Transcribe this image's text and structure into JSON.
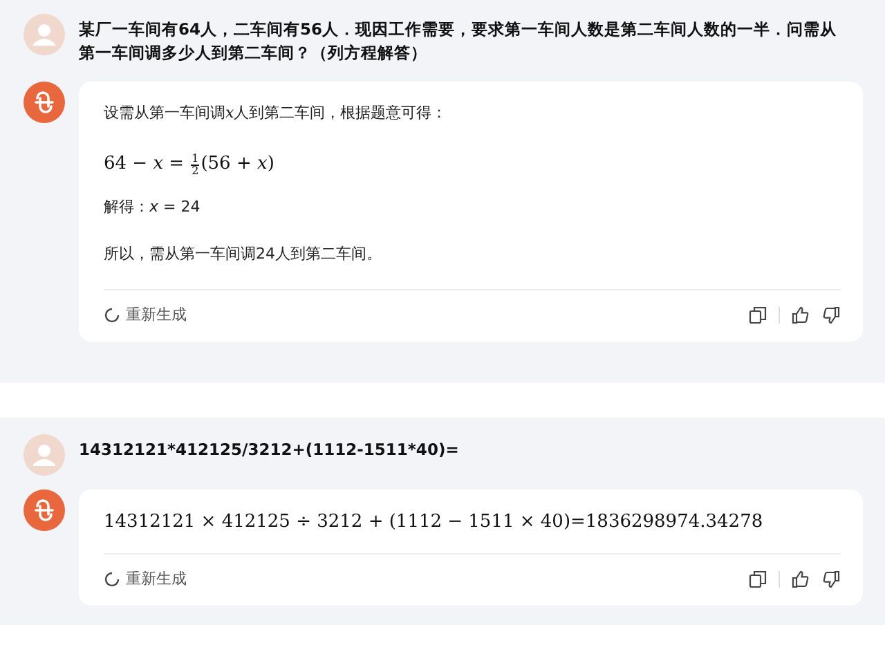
{
  "conversations": [
    {
      "question": "某厂一车间有64人，二车间有56人．现因工作需要，要求第一车间人数是第二车间人数的一半．问需从第一车间调多少人到第二车间？（列方程解答）",
      "answer": [
        {
          "kind": "text_var",
          "before": "设需从第一车间调",
          "var": "x",
          "after": "人到第二车间，根据题意可得："
        },
        {
          "kind": "fraction_equation",
          "left": "64 − *x* =",
          "numerator": "1",
          "denominator": "2",
          "right": "(56 + *x*)"
        },
        {
          "kind": "text",
          "text": "解得：*x* = 24"
        },
        {
          "kind": "text",
          "text": "所以，需从第一车间调24人到第二车间。"
        }
      ],
      "regenerate": "重新生成"
    },
    {
      "question": "14312121*412125/3212+(1112-1511*40)=",
      "answer": [
        {
          "kind": "math",
          "text": "14312121 × 412125 ÷ 3212 + (1112 − 1511 × 40)=1836298974.34278"
        }
      ],
      "regenerate": "重新生成"
    }
  ]
}
